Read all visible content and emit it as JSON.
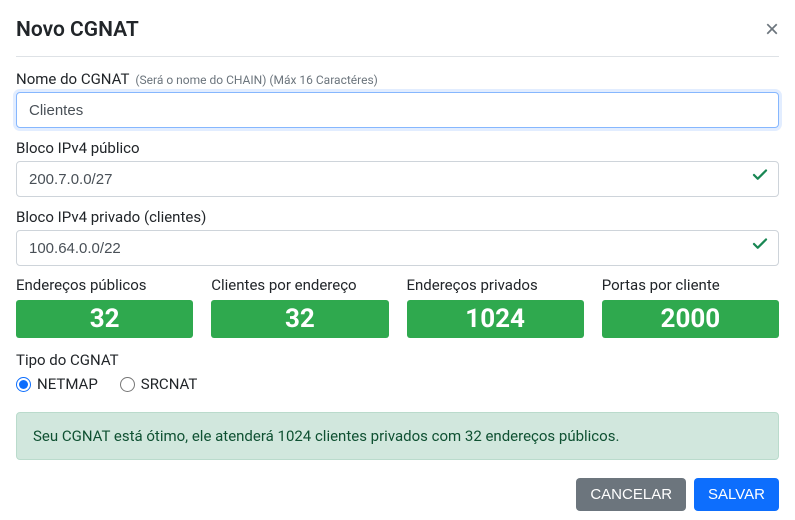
{
  "header": {
    "title": "Novo CGNAT"
  },
  "form": {
    "name": {
      "label": "Nome do CGNAT",
      "hint": "(Será o nome do CHAIN) (Máx 16 Caractéres)",
      "value": "Clientes"
    },
    "public_block": {
      "label": "Bloco IPv4 público",
      "value": "200.7.0.0/27"
    },
    "private_block": {
      "label": "Bloco IPv4 privado (clientes)",
      "value": "100.64.0.0/22"
    }
  },
  "stats": [
    {
      "label": "Endereços públicos",
      "value": "32"
    },
    {
      "label": "Clientes por endereço",
      "value": "32"
    },
    {
      "label": "Endereços privados",
      "value": "1024"
    },
    {
      "label": "Portas por cliente",
      "value": "2000"
    }
  ],
  "type": {
    "label": "Tipo do CGNAT",
    "options": [
      {
        "label": "NETMAP",
        "selected": true
      },
      {
        "label": "SRCNAT",
        "selected": false
      }
    ]
  },
  "alert": "Seu CGNAT está ótimo, ele atenderá 1024 clientes privados com 32 endereços públicos.",
  "footer": {
    "cancel": "CANCELAR",
    "save": "SALVAR"
  }
}
